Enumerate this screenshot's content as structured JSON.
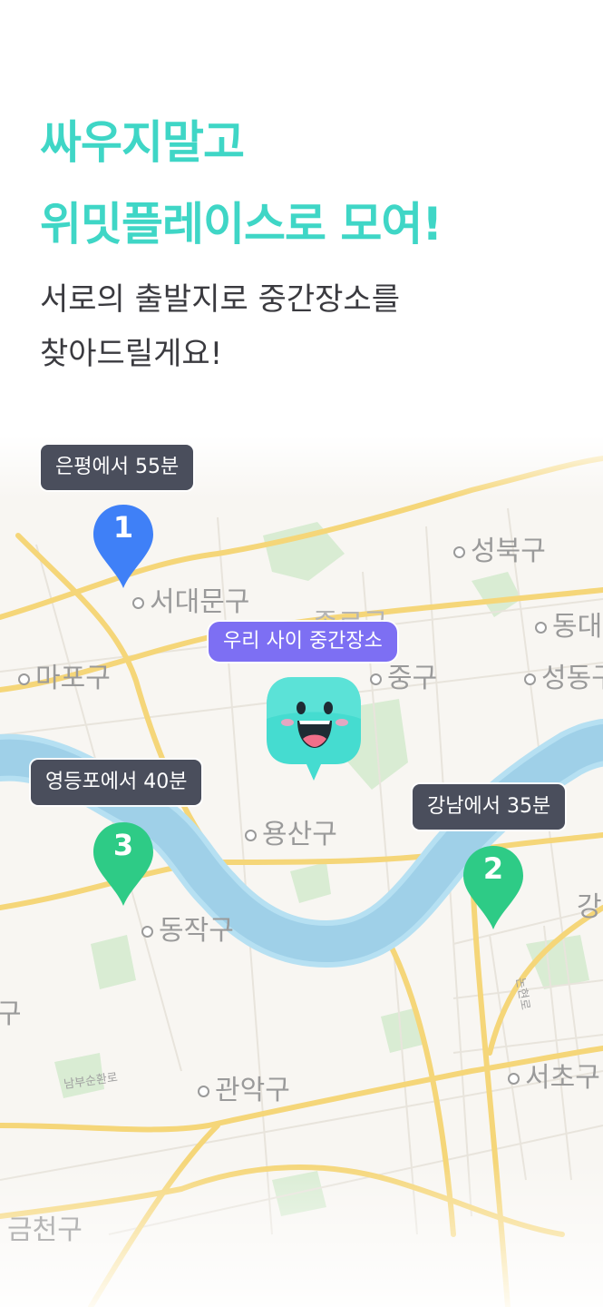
{
  "headline": {
    "line1": "싸우지말고",
    "line2": "위밋플레이스로 모여!"
  },
  "subtitle": {
    "line1": "서로의 출발지로 중간장소를",
    "line2": "찾아드릴게요!"
  },
  "map": {
    "districts": [
      "성북구",
      "서대문구",
      "종로구",
      "동대",
      "마포구",
      "중구",
      "성동구",
      "용산구",
      "강",
      "동작구",
      "구",
      "서초구",
      "관악구",
      "금천구"
    ],
    "road_labels": [
      "남부순환로",
      "논현로"
    ],
    "middle_place_label": "우리 사이 중간장소",
    "origins": [
      {
        "label": "은평에서 55분",
        "number": "1",
        "color": "#3f80f7"
      },
      {
        "label": "강남에서 35분",
        "number": "2",
        "color": "#2ecb86"
      },
      {
        "label": "영등포에서 40분",
        "number": "3",
        "color": "#2ecb86"
      }
    ]
  },
  "colors": {
    "accent": "#3fd6c6",
    "bubble": "#4a4e5c",
    "purple": "#7d6ff3",
    "river": "#9fd0e8"
  },
  "icons": {
    "mascot": "smiling-mascot-icon",
    "pin": "map-pin-icon"
  }
}
